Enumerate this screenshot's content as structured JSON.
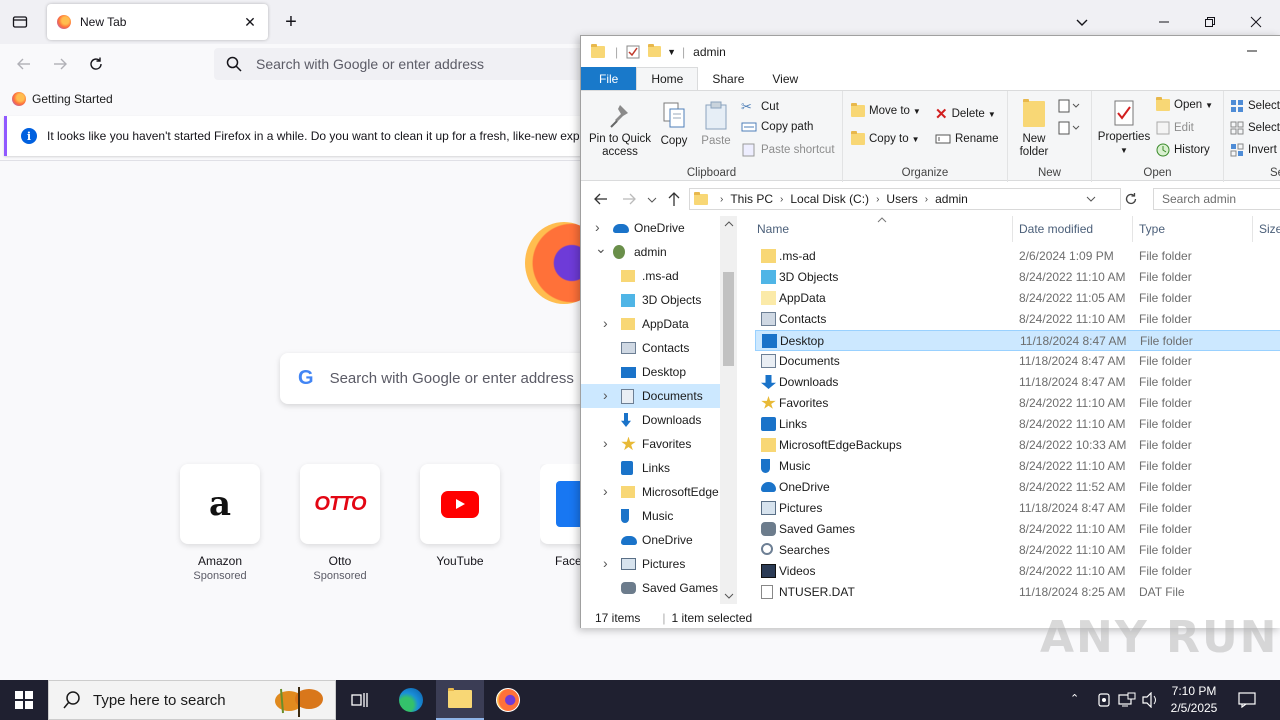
{
  "firefox": {
    "tab_title": "New Tab",
    "url_placeholder": "Search with Google or enter address",
    "bookmark": "Getting Started",
    "notice": "It looks like you haven't started Firefox in a while. Do you want to clean it up for a fresh, like-new expe",
    "search_placeholder": "Search with Google or enter address",
    "tiles": [
      {
        "name": "Amazon",
        "sponsored": "Sponsored"
      },
      {
        "name": "Otto",
        "sponsored": "Sponsored"
      },
      {
        "name": "YouTube",
        "sponsored": ""
      },
      {
        "name": "Face",
        "sponsored": ""
      }
    ]
  },
  "explorer": {
    "title": "admin",
    "tabs": [
      "File",
      "Home",
      "Share",
      "View"
    ],
    "ribbon": {
      "clipboard": {
        "label": "Clipboard",
        "pin": "Pin to Quick access",
        "copy": "Copy",
        "paste": "Paste",
        "cut": "Cut",
        "copy_path": "Copy path",
        "paste_shortcut": "Paste shortcut"
      },
      "organize": {
        "label": "Organize",
        "move_to": "Move to",
        "copy_to": "Copy to",
        "delete": "Delete",
        "rename": "Rename"
      },
      "new": {
        "label": "New",
        "new_folder": "New folder"
      },
      "open": {
        "label": "Open",
        "properties": "Properties",
        "open": "Open",
        "edit": "Edit",
        "history": "History"
      },
      "select": {
        "label": "Sel",
        "select_all": "Select",
        "select_none": "Select",
        "invert": "Invert"
      }
    },
    "breadcrumb": [
      "This PC",
      "Local Disk (C:)",
      "Users",
      "admin"
    ],
    "search_placeholder": "Search admin",
    "nav": [
      {
        "label": "OneDrive",
        "icon": "onedrive-icon"
      },
      {
        "label": "admin",
        "icon": "user-icon"
      },
      {
        "label": ".ms-ad",
        "icon": "folder-icon"
      },
      {
        "label": "3D Objects",
        "icon": "3d-objects-icon"
      },
      {
        "label": "AppData",
        "icon": "folder-icon"
      },
      {
        "label": "Contacts",
        "icon": "contacts-icon"
      },
      {
        "label": "Desktop",
        "icon": "desktop-icon"
      },
      {
        "label": "Documents",
        "icon": "documents-icon"
      },
      {
        "label": "Downloads",
        "icon": "downloads-icon"
      },
      {
        "label": "Favorites",
        "icon": "star-icon"
      },
      {
        "label": "Links",
        "icon": "links-icon"
      },
      {
        "label": "MicrosoftEdge",
        "icon": "folder-icon"
      },
      {
        "label": "Music",
        "icon": "music-icon"
      },
      {
        "label": "OneDrive",
        "icon": "onedrive-icon"
      },
      {
        "label": "Pictures",
        "icon": "pictures-icon"
      },
      {
        "label": "Saved Games",
        "icon": "saved-games-icon"
      }
    ],
    "columns": [
      "Name",
      "Date modified",
      "Type",
      "Size"
    ],
    "files": [
      {
        "name": ".ms-ad",
        "date": "2/6/2024 1:09 PM",
        "type": "File folder"
      },
      {
        "name": "3D Objects",
        "date": "8/24/2022 11:10 AM",
        "type": "File folder"
      },
      {
        "name": "AppData",
        "date": "8/24/2022 11:05 AM",
        "type": "File folder"
      },
      {
        "name": "Contacts",
        "date": "8/24/2022 11:10 AM",
        "type": "File folder"
      },
      {
        "name": "Desktop",
        "date": "11/18/2024 8:47 AM",
        "type": "File folder"
      },
      {
        "name": "Documents",
        "date": "11/18/2024 8:47 AM",
        "type": "File folder"
      },
      {
        "name": "Downloads",
        "date": "11/18/2024 8:47 AM",
        "type": "File folder"
      },
      {
        "name": "Favorites",
        "date": "8/24/2022 11:10 AM",
        "type": "File folder"
      },
      {
        "name": "Links",
        "date": "8/24/2022 11:10 AM",
        "type": "File folder"
      },
      {
        "name": "MicrosoftEdgeBackups",
        "date": "8/24/2022 10:33 AM",
        "type": "File folder"
      },
      {
        "name": "Music",
        "date": "8/24/2022 11:10 AM",
        "type": "File folder"
      },
      {
        "name": "OneDrive",
        "date": "8/24/2022 11:52 AM",
        "type": "File folder"
      },
      {
        "name": "Pictures",
        "date": "11/18/2024 8:47 AM",
        "type": "File folder"
      },
      {
        "name": "Saved Games",
        "date": "8/24/2022 11:10 AM",
        "type": "File folder"
      },
      {
        "name": "Searches",
        "date": "8/24/2022 11:10 AM",
        "type": "File folder"
      },
      {
        "name": "Videos",
        "date": "8/24/2022 11:10 AM",
        "type": "File folder"
      },
      {
        "name": "NTUSER.DAT",
        "date": "11/18/2024 8:25 AM",
        "type": "DAT File"
      }
    ],
    "status_items": "17 items",
    "status_selected": "1 item selected"
  },
  "taskbar": {
    "search_placeholder": "Type here to search",
    "time": "7:10 PM",
    "date": "2/5/2025"
  },
  "watermark": "ANY RUN"
}
